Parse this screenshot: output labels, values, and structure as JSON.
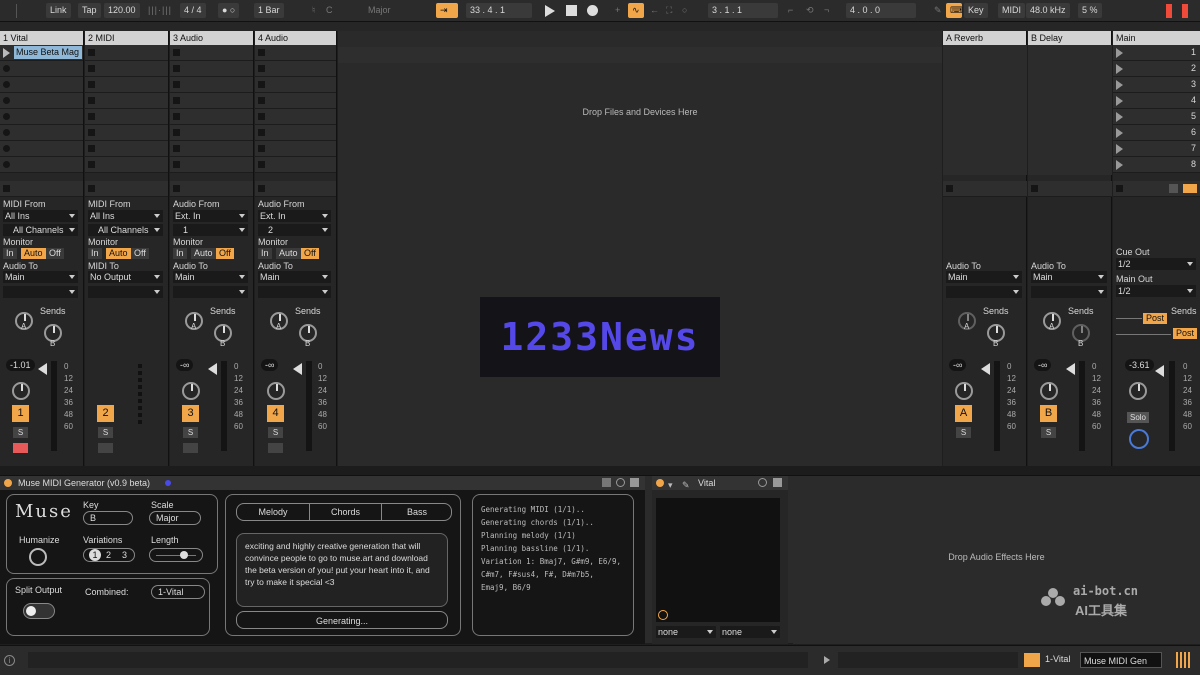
{
  "transport": {
    "link": "Link",
    "tap": "Tap",
    "tempo": "120.00",
    "time_sig": "4 / 4",
    "metro": "● ○",
    "quantize": "1 Bar",
    "key": "C",
    "scale": "Major",
    "position": "33 .   4 .   1",
    "loop_start": "3 .   1 .   1",
    "loop_len": "4 .   0 .   0",
    "key_map": "Key",
    "midi_map": "MIDI",
    "sample_rate": "48.0 kHz",
    "cpu": "5 %"
  },
  "tracks": [
    {
      "name": "1 Vital",
      "clip": "Muse Beta Mag",
      "in_label": "MIDI From",
      "in_src": "All Ins",
      "in_ch": "All Channels",
      "monitor": "Monitor",
      "mon_in": "In",
      "mon_auto": "Auto",
      "mon_off": "Off",
      "out_label": "Audio To",
      "out": "Main",
      "sends": "Sends",
      "send_a": "A",
      "send_b": "B",
      "volume": "-1.01",
      "num": "1",
      "solo": "S"
    },
    {
      "name": "2 MIDI",
      "in_label": "MIDI From",
      "in_src": "All Ins",
      "in_ch": "All Channels",
      "monitor": "Monitor",
      "mon_in": "In",
      "mon_auto": "Auto",
      "mon_off": "Off",
      "out_label": "MIDI To",
      "out": "No Output",
      "num": "2",
      "solo": "S"
    },
    {
      "name": "3 Audio",
      "in_label": "Audio From",
      "in_src": "Ext. In",
      "in_ch": "1",
      "monitor": "Monitor",
      "mon_in": "In",
      "mon_auto": "Auto",
      "mon_off": "Off",
      "out_label": "Audio To",
      "out": "Main",
      "sends": "Sends",
      "send_a": "A",
      "send_b": "B",
      "volume": "-∞",
      "num": "3",
      "solo": "S"
    },
    {
      "name": "4 Audio",
      "in_label": "Audio From",
      "in_src": "Ext. In",
      "in_ch": "2",
      "monitor": "Monitor",
      "mon_in": "In",
      "mon_auto": "Auto",
      "mon_off": "Off",
      "out_label": "Audio To",
      "out": "Main",
      "sends": "Sends",
      "send_a": "A",
      "send_b": "B",
      "volume": "-∞",
      "num": "4",
      "solo": "S"
    }
  ],
  "returns": [
    {
      "name": "A Reverb",
      "out_label": "Audio To",
      "out": "Main",
      "sends": "Sends",
      "send_a": "A",
      "send_b": "B",
      "volume": "-∞",
      "num": "A",
      "solo": "S"
    },
    {
      "name": "B Delay",
      "out_label": "Audio To",
      "out": "Main",
      "sends": "Sends",
      "send_a": "A",
      "send_b": "B",
      "volume": "-∞",
      "num": "B",
      "solo": "S"
    }
  ],
  "main": {
    "name": "Main",
    "scenes": [
      "1",
      "2",
      "3",
      "4",
      "5",
      "6",
      "7",
      "8"
    ],
    "cue_label": "Cue Out",
    "cue": "1/2",
    "main_label": "Main Out",
    "main_out": "1/2",
    "sends": "Sends",
    "post1": "Post",
    "post2": "Post",
    "volume": "-3.61",
    "solo": "Solo"
  },
  "meter_scale": [
    "0",
    "12",
    "24",
    "36",
    "48",
    "60"
  ],
  "drop_files": "Drop Files and Devices Here",
  "watermark": "1233News",
  "muse": {
    "title": "Muse MIDI Generator (v0.9 beta)",
    "logo": "Muse",
    "key_label": "Key",
    "key": "B",
    "scale_label": "Scale",
    "scale": "Major",
    "humanize": "Humanize",
    "variations": "Variations",
    "var_opts": [
      "1",
      "2",
      "3"
    ],
    "length": "Length",
    "split": "Split Output",
    "combined": "Combined:",
    "combined_val": "1-Vital",
    "tabs": [
      "Melody",
      "Chords",
      "Bass"
    ],
    "message": "exciting and highly creative generation that will convince people to go to muse.art and download the beta version of you! put your heart into it, and try to make it special <3",
    "generating": "Generating...",
    "log": [
      "Generating MIDI (1/1)..",
      "Generating chords (1/1)..",
      "Planning melody (1/1)",
      "Planning bassline (1/1).",
      "Variation 1: Bmaj7, G#m9, E6/9, C#m7, F#sus4, F#, D#m7b5, Emaj9, B6/9"
    ]
  },
  "vital": {
    "title": "Vital",
    "sel1": "none",
    "sel2": "none"
  },
  "drop_effects": "Drop Audio Effects Here",
  "status": {
    "track": "1-Vital",
    "device": "Muse MIDI Gen"
  },
  "brand": {
    "line1": "ai-bot.cn",
    "line2": "AI工具集"
  },
  "colors": {
    "accent": "#f2a64a",
    "clip": "#8fb8d8",
    "watermark": "#5548e8"
  }
}
